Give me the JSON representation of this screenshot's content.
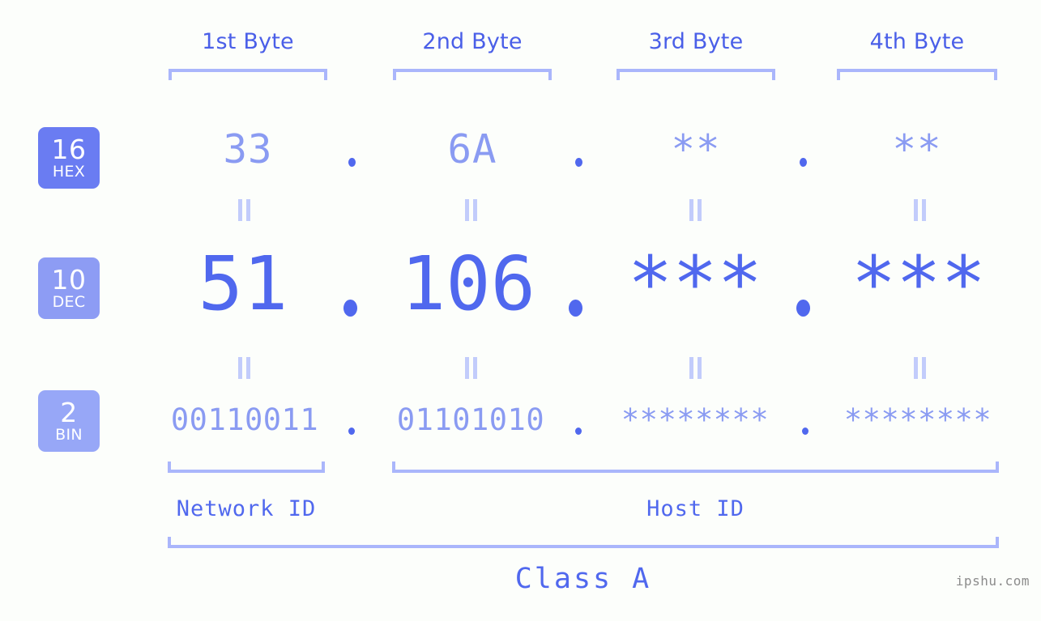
{
  "byte_headers": [
    {
      "label": "1st Byte"
    },
    {
      "label": "2nd Byte"
    },
    {
      "label": "3rd Byte"
    },
    {
      "label": "4th Byte"
    }
  ],
  "bases": [
    {
      "num": "16",
      "name": "HEX",
      "color": "#6a7cf2"
    },
    {
      "num": "10",
      "name": "DEC",
      "color": "#8d9cf4"
    },
    {
      "num": "2",
      "name": "BIN",
      "color": "#97a7f7"
    }
  ],
  "rows": {
    "hex": {
      "octets": [
        "33",
        "6A",
        "**",
        "**"
      ],
      "separator": "."
    },
    "dec": {
      "octets": [
        "51",
        "106",
        "***",
        "***"
      ],
      "separator": "."
    },
    "bin": {
      "octets": [
        "00110011",
        "01101010",
        "********",
        "********"
      ],
      "separator": "."
    }
  },
  "equality_symbol": "||",
  "regions": [
    {
      "label": "Network ID"
    },
    {
      "label": "Host ID"
    }
  ],
  "class": {
    "label": "Class A"
  },
  "watermark": {
    "text": "ipshu.com"
  },
  "colors": {
    "accent": "#5068ee",
    "accent_light": "#8a9bf2",
    "bracket": "#aab6fb",
    "connector": "#c2ccfb",
    "header_text": "#4a5fe8",
    "background": "#fcfefb",
    "watermark": "#8c8c8c"
  }
}
